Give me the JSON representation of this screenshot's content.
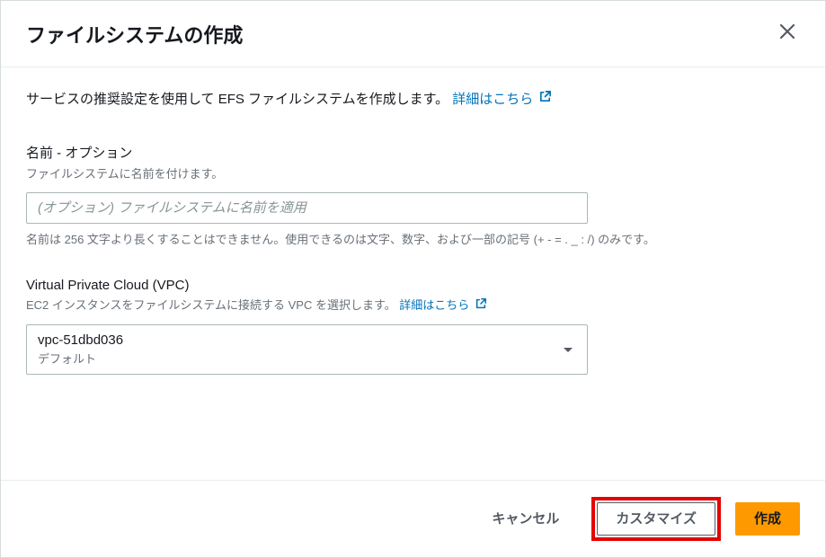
{
  "header": {
    "title": "ファイルシステムの作成"
  },
  "body": {
    "intro": "サービスの推奨設定を使用して EFS ファイルシステムを作成します。",
    "learn_more": "詳細はこちら",
    "name_field": {
      "label": "名前 - オプション",
      "sublabel": "ファイルシステムに名前を付けます。",
      "placeholder": "(オプション) ファイルシステムに名前を適用",
      "hint": "名前は 256 文字より長くすることはできません。使用できるのは文字、数字、および一部の記号 (+ - = . _ : /) のみです。"
    },
    "vpc_field": {
      "label": "Virtual Private Cloud (VPC)",
      "sublabel": "EC2 インスタンスをファイルシステムに接続する VPC を選択します。",
      "learn_more": "詳細はこちら",
      "value": "vpc-51dbd036",
      "subvalue": "デフォルト"
    }
  },
  "footer": {
    "cancel": "キャンセル",
    "customize": "カスタマイズ",
    "create": "作成"
  }
}
